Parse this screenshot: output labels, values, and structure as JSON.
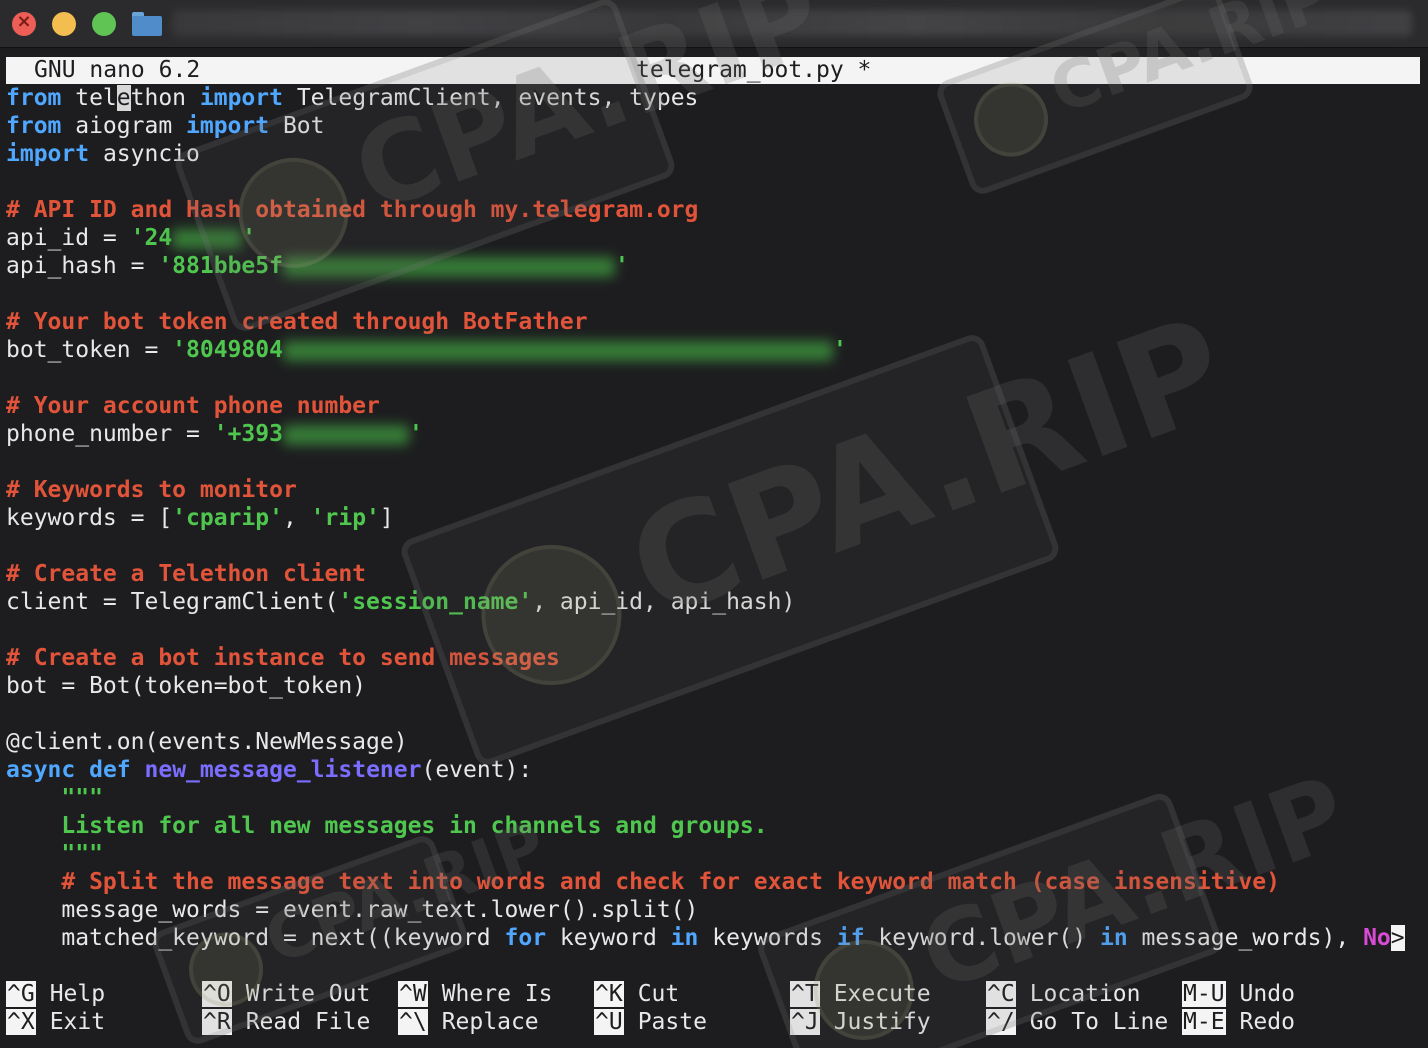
{
  "window": {
    "controls": [
      "close",
      "minimize",
      "zoom"
    ],
    "icon": "folder-icon"
  },
  "nano": {
    "version": "GNU nano 6.2",
    "filename": "telegram_bot.py *"
  },
  "code": {
    "l1": {
      "a": "from",
      "b": " tel",
      "c": "e",
      "d": "thon ",
      "e": "import",
      "f": " TelegramClient, events, types"
    },
    "l2": {
      "a": "from",
      "b": " aiogram ",
      "c": "import",
      "d": " Bot"
    },
    "l3": {
      "a": "import",
      "b": " asyncio"
    },
    "l5": "# API ID and Hash obtained through my.telegram.org",
    "l6": {
      "a": "api_id = ",
      "b": "'24",
      "c": "'"
    },
    "l7": {
      "a": "api_hash = ",
      "b": "'881bbe5f",
      "c": "'"
    },
    "l9": "# Your bot token created through BotFather",
    "l10": {
      "a": "bot_token = ",
      "b": "'8049804",
      "c": "'"
    },
    "l12": "# Your account phone number",
    "l13": {
      "a": "phone_number = ",
      "b": "'+393",
      "c": "'"
    },
    "l15": "# Keywords to monitor",
    "l16": {
      "a": "keywords = [",
      "b": "'cparip'",
      "c": ", ",
      "d": "'rip'",
      "e": "]"
    },
    "l18": "# Create a Telethon client",
    "l19": {
      "a": "client = TelegramClient(",
      "b": "'session_name'",
      "c": ", api_id, api_hash)"
    },
    "l21": "# Create a bot instance to send messages",
    "l22": "bot = Bot(token=bot_token)",
    "l24": "@client.on(events.NewMessage)",
    "l25": {
      "a": "async",
      "b": " ",
      "c": "def",
      "d": " ",
      "e": "new_message_listener",
      "f": "(event):"
    },
    "l26": "    \"\"\"",
    "l27": "    Listen for all new messages in channels and groups.",
    "l28": "    \"\"\"",
    "l29": "    # Split the message text into words and check for exact keyword match (case insensitive)",
    "l30": "    message_words = event.raw_text.lower().split()",
    "l31": {
      "a": "    matched_keyword = next((keyword ",
      "b": "for",
      "c": " keyword ",
      "d": "in",
      "e": " keywords ",
      "f": "if",
      "g": " keyword.lower() ",
      "h": "in",
      "i": " message_words), ",
      "j": "No",
      "k": ">"
    }
  },
  "shortcuts": [
    {
      "key": "^G",
      "label": "Help"
    },
    {
      "key": "^O",
      "label": "Write Out"
    },
    {
      "key": "^W",
      "label": "Where Is"
    },
    {
      "key": "^K",
      "label": "Cut"
    },
    {
      "key": "^T",
      "label": "Execute"
    },
    {
      "key": "^C",
      "label": "Location"
    },
    {
      "key": "M-U",
      "label": "Undo"
    },
    {
      "key": "^X",
      "label": "Exit"
    },
    {
      "key": "^R",
      "label": "Read File"
    },
    {
      "key": "^\\",
      "label": "Replace"
    },
    {
      "key": "^U",
      "label": "Paste"
    },
    {
      "key": "^J",
      "label": "Justify"
    },
    {
      "key": "^/",
      "label": "Go To Line"
    },
    {
      "key": "M-E",
      "label": "Redo"
    }
  ],
  "watermark": {
    "text": "CPA.RIP"
  },
  "colors": {
    "keyword": "#4fa7ff",
    "comment": "#e2543a",
    "string": "#4fc74f",
    "function": "#7a6dff",
    "background": "#1d1d1f"
  }
}
